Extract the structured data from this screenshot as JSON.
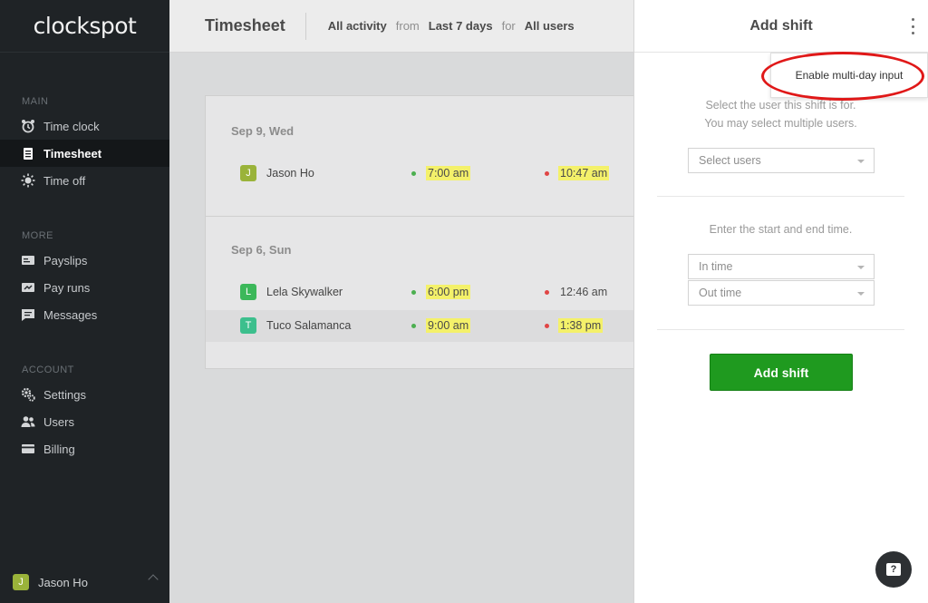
{
  "app": {
    "logo": "clockspot"
  },
  "sidebar": {
    "sections": [
      {
        "title": "MAIN",
        "items": [
          {
            "label": "Time clock",
            "icon": "alarm-clock-icon"
          },
          {
            "label": "Timesheet",
            "icon": "clipboard-icon",
            "active": true
          },
          {
            "label": "Time off",
            "icon": "sun-icon"
          }
        ]
      },
      {
        "title": "MORE",
        "items": [
          {
            "label": "Payslips",
            "icon": "payslip-icon"
          },
          {
            "label": "Pay runs",
            "icon": "pay-run-icon"
          },
          {
            "label": "Messages",
            "icon": "message-icon"
          }
        ]
      },
      {
        "title": "ACCOUNT",
        "items": [
          {
            "label": "Settings",
            "icon": "gear-icon"
          },
          {
            "label": "Users",
            "icon": "users-icon"
          },
          {
            "label": "Billing",
            "icon": "credit-card-icon"
          }
        ]
      }
    ],
    "current_user": {
      "initial": "J",
      "name": "Jason Ho"
    }
  },
  "header": {
    "title": "Timesheet",
    "activity": "All activity",
    "from_word": "from",
    "range": "Last 7 days",
    "for_word": "for",
    "users": "All users"
  },
  "timesheet": {
    "days": [
      {
        "date": "Sep 9, Wed",
        "entries": [
          {
            "initial": "J",
            "name": "Jason Ho",
            "in": "7:00 am",
            "out": "10:47 am",
            "color": "#9ab33a",
            "in_hl": true,
            "out_hl": true
          }
        ]
      },
      {
        "date": "Sep 6, Sun",
        "entries": [
          {
            "initial": "L",
            "name": "Lela Skywalker",
            "in": "6:00 pm",
            "out": "12:46 am",
            "color": "#3cb85a",
            "in_hl": true,
            "out_hl": false
          },
          {
            "initial": "T",
            "name": "Tuco Salamanca",
            "in": "9:00 am",
            "out": "1:38 pm",
            "color": "#3cbf8d",
            "in_hl": true,
            "out_hl": true
          }
        ]
      }
    ]
  },
  "panel": {
    "title": "Add shift",
    "menu_item": "Enable multi-day input",
    "user_instruction_1": "Select the user this shift is for.",
    "user_instruction_2": "You may select multiple users.",
    "select_users_placeholder": "Select users",
    "time_instruction": "Enter the start and end time.",
    "in_time_placeholder": "In time",
    "out_time_placeholder": "Out time",
    "submit_label": "Add shift"
  },
  "help": {
    "label": "?"
  },
  "colors": {
    "sidebar_bg": "#1f2326",
    "primary_button": "#1f9a1f",
    "highlight": "#f4f16a",
    "annotation_ring": "#e01818"
  }
}
